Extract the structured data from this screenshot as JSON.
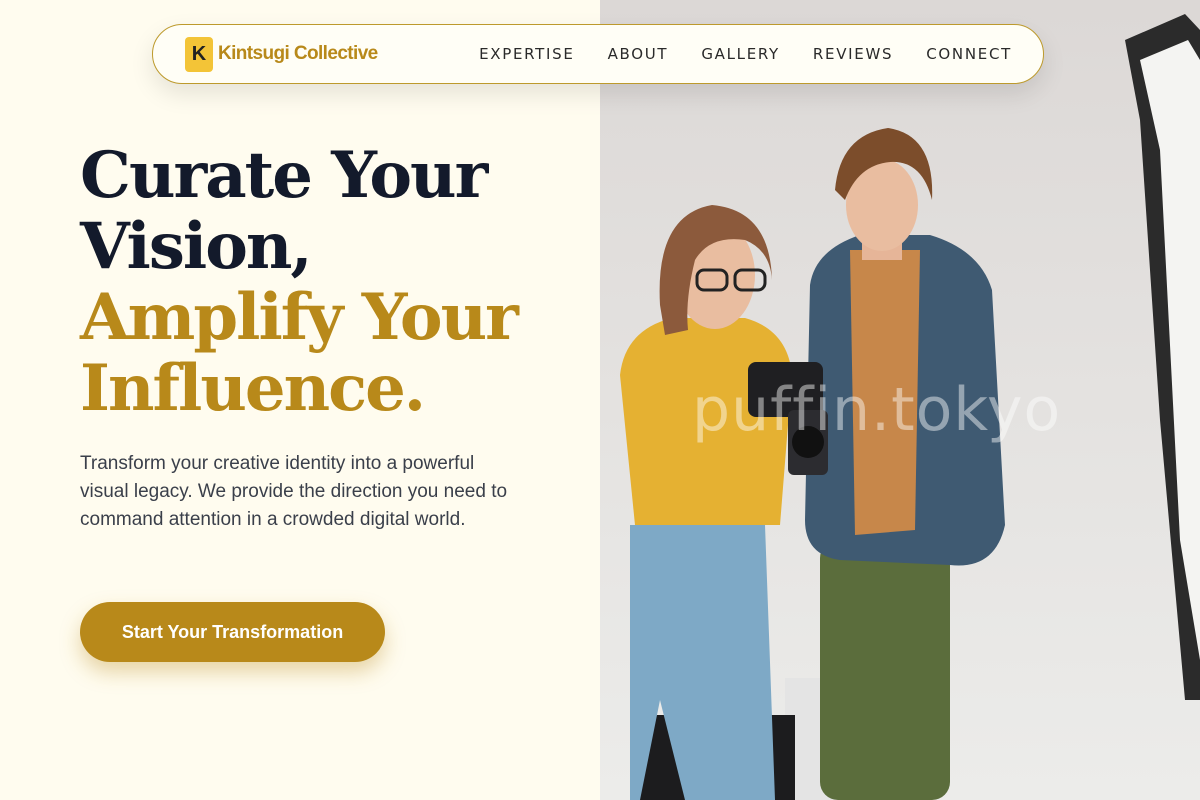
{
  "brand": {
    "mark": "K",
    "name": "Kintsugi Collective"
  },
  "nav": {
    "items": [
      "EXPERTISE",
      "ABOUT",
      "GALLERY",
      "REVIEWS",
      "CONNECT"
    ]
  },
  "hero": {
    "headline_lines": [
      "Curate Your",
      "Vision,",
      "Amplify Your",
      "Influence."
    ],
    "description": "Transform your creative identity into a powerful visual legacy. We provide the direction you need to command attention in a crowded digital world.",
    "cta_label": "Start Your Transformation"
  },
  "photo": {
    "watermark": "puffin.tokyo"
  },
  "colors": {
    "accent": "#b8891a",
    "heading": "#131a2b",
    "background": "#fffcef",
    "logo_mark": "#f3c437"
  }
}
